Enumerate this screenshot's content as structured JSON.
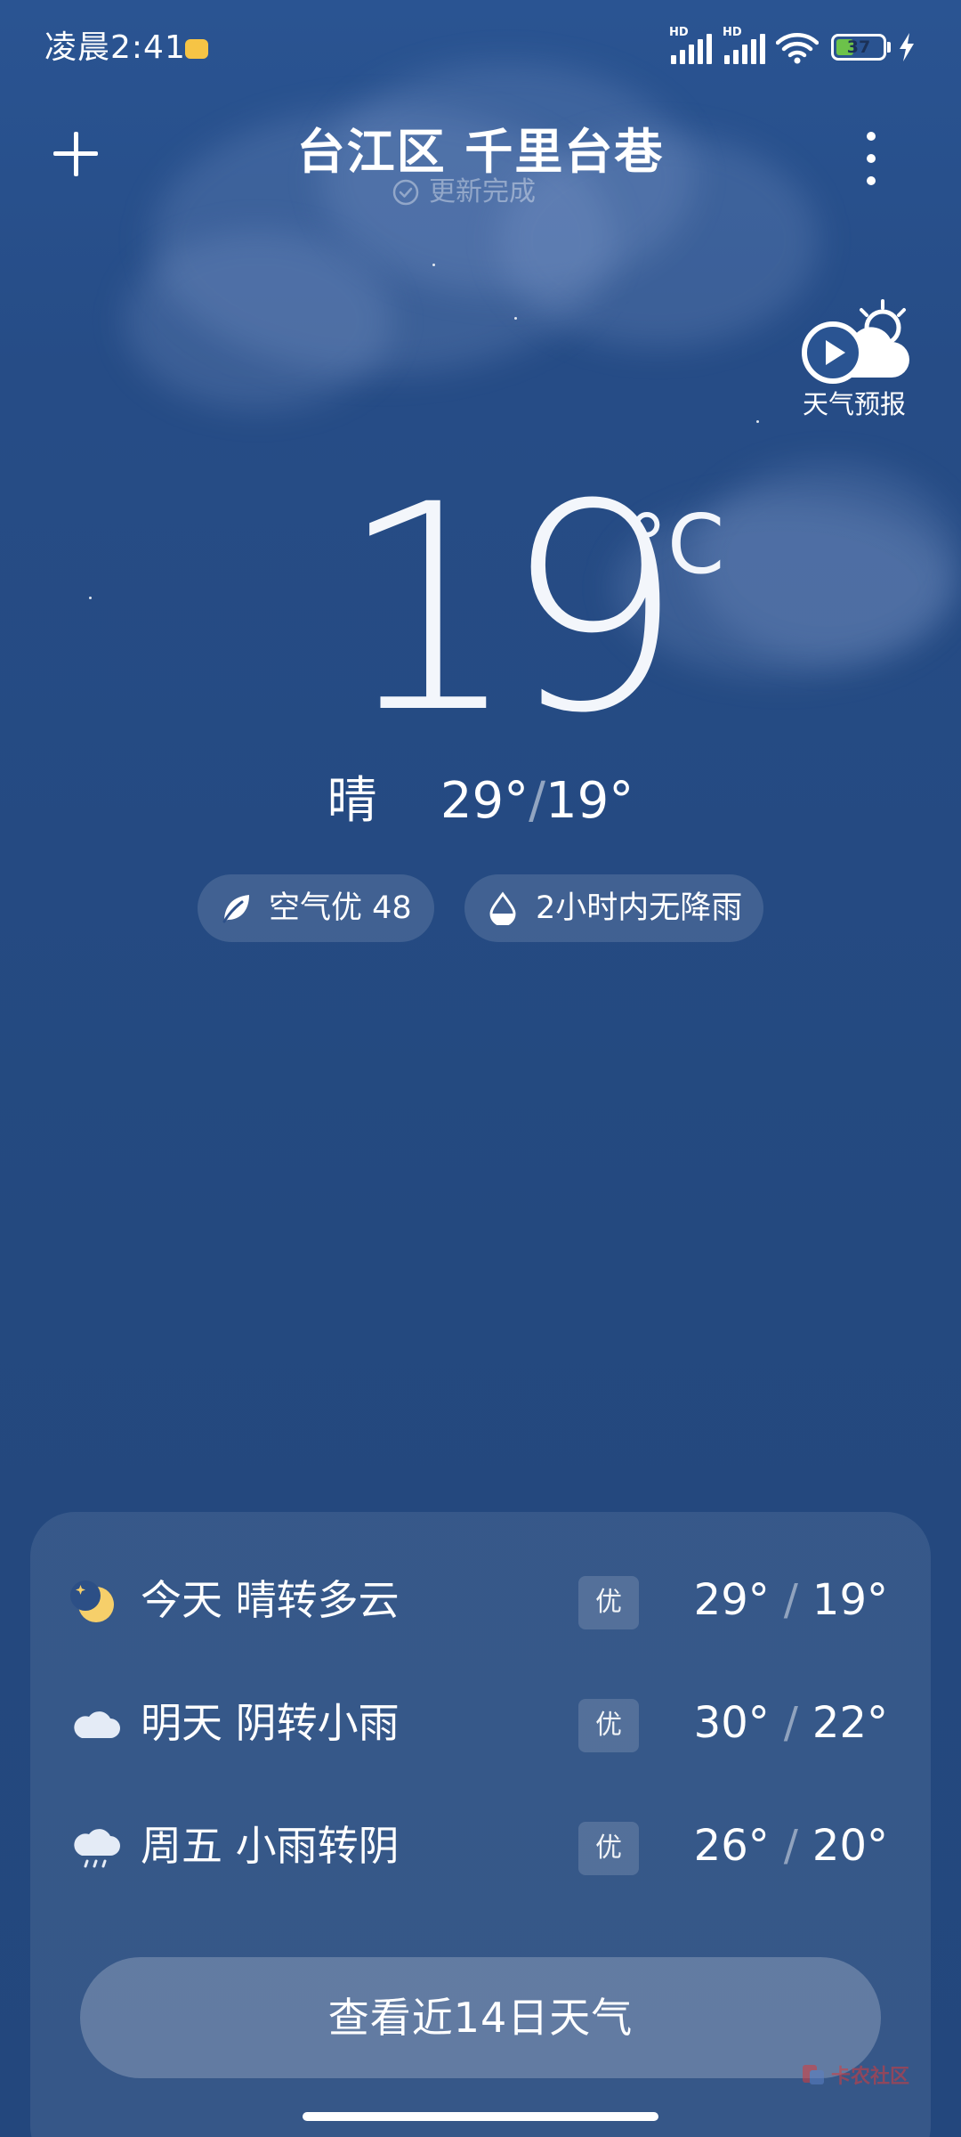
{
  "status_bar": {
    "time": "凌晨2:41",
    "sim1_label": "HD",
    "sim2_label": "HD",
    "battery_level": "37",
    "battery_percent": 37,
    "icons": [
      "notification-icon",
      "signal-icon",
      "signal-icon",
      "wifi-icon",
      "battery-icon",
      "charging-icon"
    ]
  },
  "header": {
    "location": "台江区 千里台巷",
    "update_status": "更新完成",
    "add_icon": "plus-icon",
    "menu_icon": "more-vertical-icon"
  },
  "forecast_video": {
    "label": "天气预报",
    "icon": "play-weather-icon"
  },
  "current": {
    "temperature": "19",
    "unit": "°C",
    "condition": "晴",
    "high": "29°",
    "low": "19°",
    "separator": "/"
  },
  "chips": {
    "air": {
      "icon": "leaf-icon",
      "label": "空气优 48"
    },
    "rain": {
      "icon": "raindrop-icon",
      "label": "2小时内无降雨"
    }
  },
  "forecast": {
    "days": [
      {
        "icon": "moon-icon",
        "name": "今天  晴转多云",
        "aqi": "优",
        "high": "29°",
        "low": "19°",
        "separator": "/"
      },
      {
        "icon": "cloud-icon",
        "name": "明天  阴转小雨",
        "aqi": "优",
        "high": "30°",
        "low": "22°",
        "separator": "/"
      },
      {
        "icon": "rain-cloud-icon",
        "name": "周五  小雨转阴",
        "aqi": "优",
        "high": "26°",
        "low": "20°",
        "separator": "/"
      }
    ],
    "button_label": "查看近14日天气"
  },
  "watermark": {
    "text": "卡农社区"
  },
  "colors": {
    "background": "#24487f",
    "battery": "#6cc24a",
    "notification": "#f6c445",
    "moon": "#f6cf6a"
  }
}
